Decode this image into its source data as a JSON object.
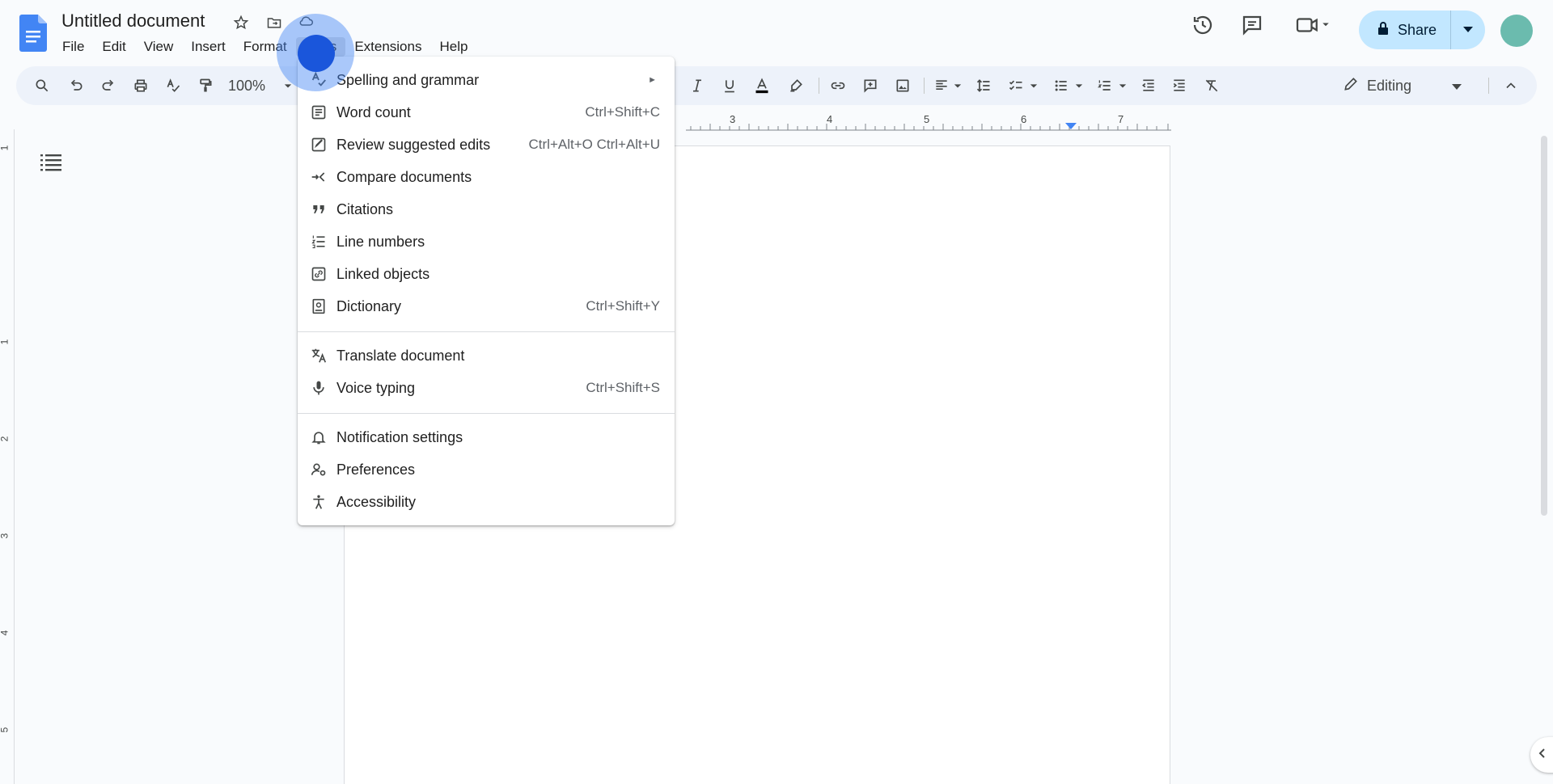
{
  "document": {
    "title": "Untitled document"
  },
  "menubar": {
    "items": [
      {
        "label": "File"
      },
      {
        "label": "Edit"
      },
      {
        "label": "View"
      },
      {
        "label": "Insert"
      },
      {
        "label": "Format"
      },
      {
        "label": "Tools"
      },
      {
        "label": "Extensions"
      },
      {
        "label": "Help"
      }
    ]
  },
  "header": {
    "share_label": "Share"
  },
  "toolbar": {
    "zoom": "100%",
    "mode_label": "Editing"
  },
  "ruler": {
    "labels": [
      "3",
      "4",
      "5",
      "6",
      "7"
    ]
  },
  "vruler": {
    "labels": [
      "1",
      "1",
      "2",
      "3",
      "4",
      "5"
    ]
  },
  "tools_menu": {
    "items": [
      {
        "label": "Spelling and grammar",
        "shortcut": "",
        "icon": "spellcheck-icon",
        "submenu": true
      },
      {
        "label": "Word count",
        "shortcut": "Ctrl+Shift+C",
        "icon": "word-count-icon"
      },
      {
        "label": "Review suggested edits",
        "shortcut": "Ctrl+Alt+O Ctrl+Alt+U",
        "icon": "review-edits-icon"
      },
      {
        "label": "Compare documents",
        "shortcut": "",
        "icon": "compare-icon"
      },
      {
        "label": "Citations",
        "shortcut": "",
        "icon": "quote-icon"
      },
      {
        "label": "Line numbers",
        "shortcut": "",
        "icon": "line-numbers-icon"
      },
      {
        "label": "Linked objects",
        "shortcut": "",
        "icon": "linked-objects-icon"
      },
      {
        "label": "Dictionary",
        "shortcut": "Ctrl+Shift+Y",
        "icon": "dictionary-icon"
      },
      {
        "label": "Translate document",
        "shortcut": "",
        "icon": "translate-icon"
      },
      {
        "label": "Voice typing",
        "shortcut": "Ctrl+Shift+S",
        "icon": "mic-icon"
      },
      {
        "label": "Notification settings",
        "shortcut": "",
        "icon": "bell-icon"
      },
      {
        "label": "Preferences",
        "shortcut": "",
        "icon": "preferences-icon"
      },
      {
        "label": "Accessibility",
        "shortcut": "",
        "icon": "accessibility-icon"
      }
    ]
  },
  "colors": {
    "accent": "#1a73e8",
    "share_bg": "#c2e7ff",
    "toolbar_bg": "#edf2fa",
    "avatar": "#6bbbae",
    "click": "#1a56db"
  }
}
